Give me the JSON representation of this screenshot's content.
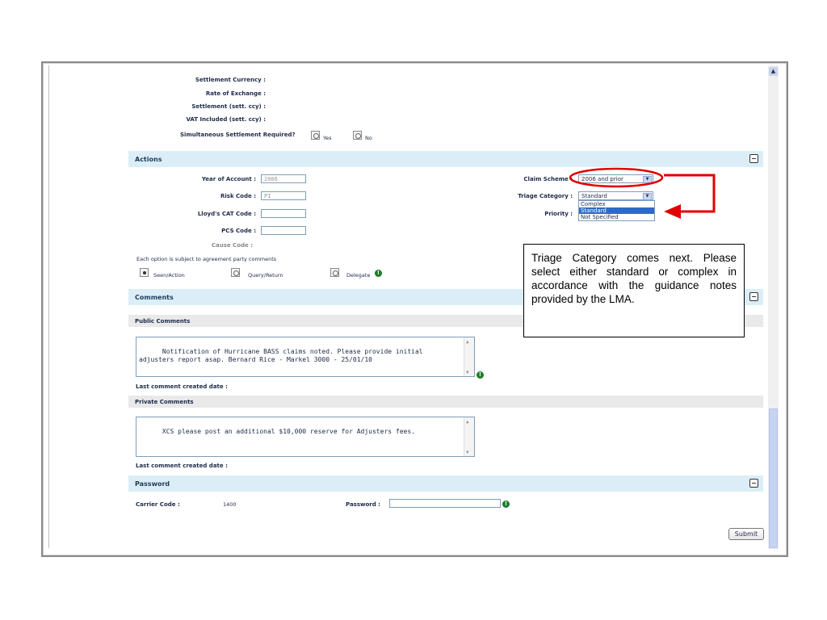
{
  "settlement": {
    "fields": [
      {
        "label": "Settlement Currency :"
      },
      {
        "label": "Rate of Exchange :"
      },
      {
        "label": "Settlement (sett. ccy) :"
      },
      {
        "label": "VAT Included (sett. ccy) :"
      }
    ],
    "simultaneous_label": "Simultaneous Settlement Required?",
    "yes_label": "Yes",
    "no_label": "No"
  },
  "actions": {
    "title": "Actions",
    "year_of_account_label": "Year of Account :",
    "year_of_account_value": "2006",
    "risk_code_label": "Risk Code :",
    "risk_code_value": "PI",
    "lloyds_cat_label": "Lloyd's CAT Code :",
    "pcs_code_label": "PCS Code :",
    "cause_code_label": "Cause Code :",
    "claim_scheme_label": "Claim Scheme :",
    "claim_scheme_value": "2006 and prior",
    "triage_category_label": "Triage Category :",
    "triage_category_value": "Standard",
    "triage_options": [
      "Complex",
      "Standard",
      "Not Specified"
    ],
    "triage_highlighted": "Standard",
    "priority_label": "Priority :",
    "note": "Each option is subject to agreement party comments",
    "options": [
      {
        "label": "Seen/Action",
        "selected": true
      },
      {
        "label": "Query/Return",
        "selected": false
      },
      {
        "label": "Delegate",
        "selected": false
      }
    ]
  },
  "comments": {
    "title": "Comments",
    "public_title": "Public Comments",
    "public_text": "Notification of Hurricane BASS claims noted. Please provide initial\nadjusters report asap. Bernard Rice - Markel 3000 - 25/01/10",
    "last_public_label": "Last comment created date :",
    "private_title": "Private Comments",
    "private_text": "XCS please post an additional $10,000 reserve for Adjusters fees.",
    "last_private_label": "Last comment created date :"
  },
  "password": {
    "title": "Password",
    "carrier_code_label": "Carrier Code :",
    "carrier_code_value": "1400",
    "password_label": "Password :"
  },
  "submit_label": "Submit",
  "callout": {
    "text": "Triage Category comes next. Please select either standard or complex in accordance with the guidance notes provided by the LMA."
  },
  "colors": {
    "section_bar": "#dbeef7",
    "annotation_red": "#e00000",
    "info_icon": "#1a7a2a",
    "highlight": "#316ac5"
  },
  "icons": [
    "collapse-icon",
    "info-icon",
    "scroll-up-icon",
    "dropdown-arrow-icon"
  ]
}
